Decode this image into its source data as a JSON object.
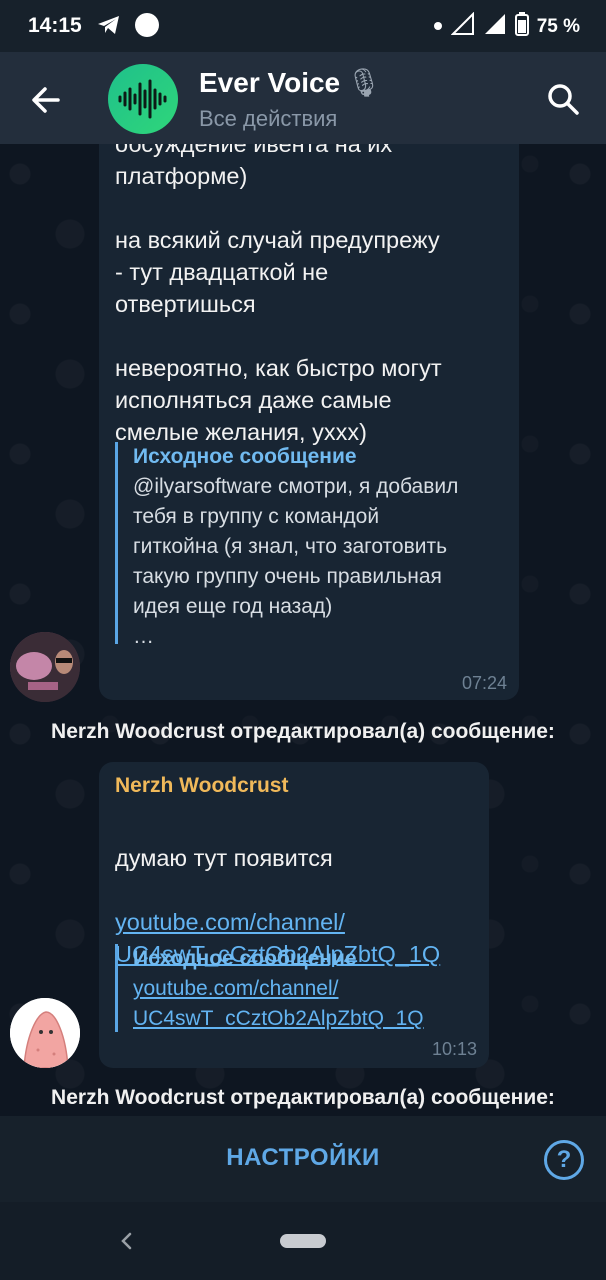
{
  "status_bar": {
    "time": "14:15",
    "battery": "75 %",
    "icons": [
      "telegram-icon",
      "circle-icon",
      "dot-icon",
      "wifi-icon",
      "signal-icon",
      "battery-icon"
    ]
  },
  "header": {
    "title": "Ever Voice",
    "title_emoji": "🎙",
    "subtitle": "Все действия"
  },
  "messages": [
    {
      "text": "обсуждение ивента на их\nплатформе)\n\nна всякий случай предупрежу\n- тут двадцаткой не\nотвертишься\n\nневероятно, как быстро могут\nисполняться даже самые\nсмелые желания, ухxx)",
      "quote_title": "Исходное сообщение",
      "quote_text": "@ilyarsoftware смотри, я добавил\nтебя в группу с командой\nгиткойна (я знал, что заготовить\nтакую группу очень правильная\nидея еще год назад)\n…",
      "time": "07:24"
    },
    {
      "sender": "Nerzh Woodcrust",
      "text": "думаю тут появится",
      "link": "youtube.com/channel/\nUC4swT_cCztOb2AlpZbtQ_1Q",
      "quote_title": "Исходное сообщение",
      "quote_link": "youtube.com/channel/\nUC4swT_cCztOb2AlpZbtQ_1Q",
      "time": "10:13"
    }
  ],
  "system_notes": [
    "Nerzh Woodcrust отредактировал(а) сообщение:",
    "Nerzh Woodcrust отредактировал(а) сообщение:"
  ],
  "bottom_bar": {
    "settings_label": "НАСТРОЙКИ",
    "help_label": "?"
  },
  "colors": {
    "accent": "#5fa8e6",
    "sender_name": "#f0b95a",
    "bubble": "#182533",
    "header": "#232e3c"
  }
}
